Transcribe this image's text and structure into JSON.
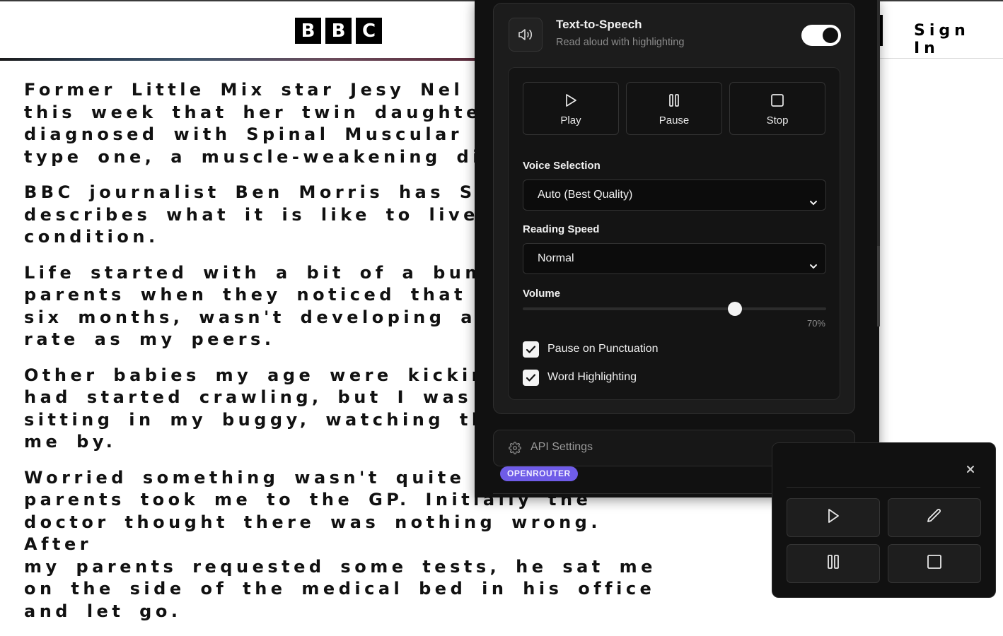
{
  "site": {
    "logo_letters": [
      "B",
      "B",
      "C"
    ],
    "sign_in_label": "Sign In"
  },
  "article": {
    "paragraphs": [
      "Former Little Mix star Jesy Nel\nthis week that her twin daughte\ndiagnosed with Spinal Muscular A\ntype one, a muscle-weakening dis",
      "BBC journalist Ben Morris has S\ndescribes what it is like to live\ncondition.",
      "Life started with a bit of a bum\nparents when they noticed that I\nsix months, wasn't developing at\nrate as my peers.",
      "Other babies my age were kicking\nhad started crawling, but I was \nsitting in my buggy, watching the\nme by.",
      "Worried something wasn't quite ri\nparents took me to the GP. Initially the\ndoctor thought there was nothing wrong. After\nmy parents requested some tests, he sat me\non the side of the medical bed in his office\nand let go."
    ]
  },
  "tts_panel": {
    "title": "Text-to-Speech",
    "subtitle": "Read aloud with highlighting",
    "enabled": true,
    "icon": "speaker-icon",
    "controls": {
      "play_label": "Play",
      "pause_label": "Pause",
      "stop_label": "Stop"
    },
    "voice_selection": {
      "label": "Voice Selection",
      "value": "Auto (Best Quality)"
    },
    "reading_speed": {
      "label": "Reading Speed",
      "value": "Normal"
    },
    "volume": {
      "label": "Volume",
      "value_text": "70%",
      "level": 0.7
    },
    "options": {
      "pause_on_punctuation": {
        "label": "Pause on Punctuation",
        "checked": true
      },
      "word_highlighting": {
        "label": "Word Highlighting",
        "checked": true
      }
    },
    "api_settings": {
      "label": "API Settings",
      "provider_badge": "OPENROUTER"
    }
  },
  "mini_player": {
    "buttons": [
      "play-icon",
      "pencil-icon",
      "pause-icon",
      "stop-icon"
    ],
    "close_icon": "close-icon"
  },
  "colors": {
    "panel_bg": "#111111",
    "badge": "#6f5ce8",
    "text_light": "#f0f0f0"
  }
}
